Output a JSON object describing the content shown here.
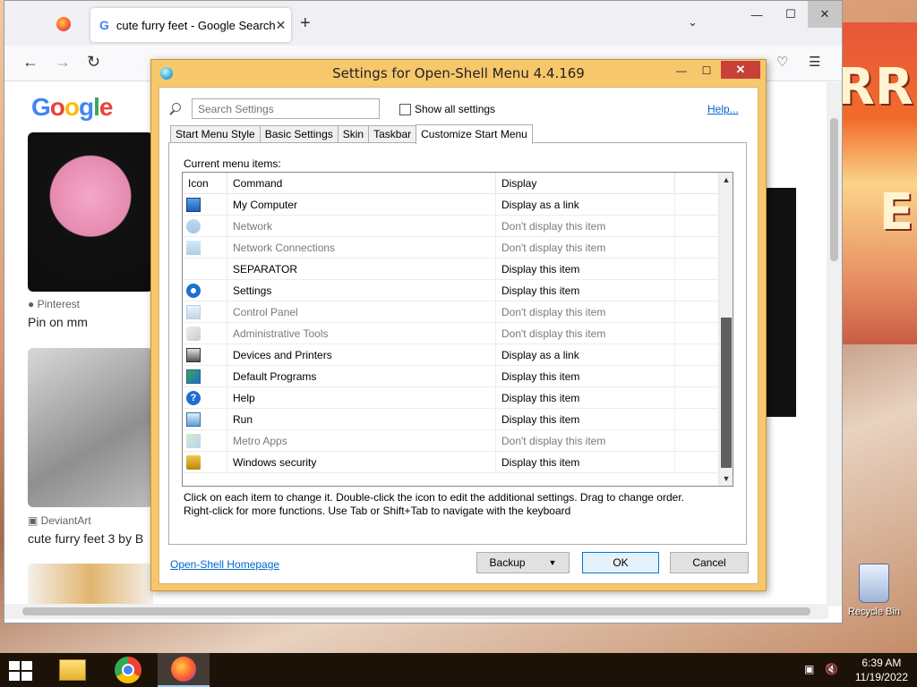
{
  "browser": {
    "tab_title": "cute furry feet - Google Search",
    "tab_close": "✕",
    "new_tab": "+",
    "tabs_menu": "⌄",
    "window_controls": [
      "—",
      "☐",
      "✕"
    ]
  },
  "page": {
    "logo": [
      "G",
      "o",
      "o",
      "g",
      "l",
      "e"
    ],
    "results": [
      {
        "source": "Pinterest",
        "title": "Pin on mm"
      },
      {
        "source": "DeviantArt",
        "title": "cute furry feet 3 by B"
      }
    ]
  },
  "dialog": {
    "title": "Settings for Open-Shell Menu 4.4.169",
    "controls": [
      "—",
      "☐",
      "✕"
    ],
    "search_placeholder": "Search Settings",
    "show_all_label": "Show all settings",
    "help_label": "Help...",
    "tabs": [
      "Start Menu Style",
      "Basic Settings",
      "Skin",
      "Taskbar",
      "Customize Start Menu"
    ],
    "active_tab": "Customize Start Menu",
    "current_items_label": "Current menu items:",
    "columns": [
      "Icon",
      "Command",
      "Display"
    ],
    "rows": [
      {
        "icon": "my-computer-icon",
        "command": "My Computer",
        "display": "Display as a link",
        "dim": false
      },
      {
        "icon": "network-icon",
        "command": "Network",
        "display": "Don't display this item",
        "dim": true
      },
      {
        "icon": "network-connections-icon",
        "command": "Network Connections",
        "display": "Don't display this item",
        "dim": true
      },
      {
        "icon": "",
        "command": "SEPARATOR",
        "display": "Display this item",
        "dim": false
      },
      {
        "icon": "settings-gear-icon",
        "command": "Settings",
        "display": "Display this item",
        "dim": false
      },
      {
        "icon": "control-panel-icon",
        "command": "Control Panel",
        "display": "Don't display this item",
        "dim": true
      },
      {
        "icon": "administrative-tools-icon",
        "command": "Administrative Tools",
        "display": "Don't display this item",
        "dim": true
      },
      {
        "icon": "printer-icon",
        "command": "Devices and Printers",
        "display": "Display as a link",
        "dim": false
      },
      {
        "icon": "default-programs-icon",
        "command": "Default Programs",
        "display": "Display this item",
        "dim": false
      },
      {
        "icon": "help-icon",
        "command": "Help",
        "display": "Display this item",
        "dim": false
      },
      {
        "icon": "run-icon",
        "command": "Run",
        "display": "Display this item",
        "dim": false
      },
      {
        "icon": "metro-apps-icon",
        "command": "Metro Apps",
        "display": "Don't display this item",
        "dim": true
      },
      {
        "icon": "lock-icon",
        "command": "Windows security",
        "display": "Display this item",
        "dim": false
      }
    ],
    "hint_line1": "Click on each item to change it. Double-click the icon to edit the additional settings. Drag to change order.",
    "hint_line2": "Right-click for more functions. Use Tab or Shift+Tab to navigate with the keyboard",
    "homepage_link": "Open-Shell Homepage",
    "backup_label": "Backup",
    "ok_label": "OK",
    "cancel_label": "Cancel"
  },
  "desktop": {
    "recycle_bin_label": "Recycle Bin"
  },
  "taskbar": {
    "time": "6:39 AM",
    "date": "11/19/2022"
  },
  "colors": {
    "dialog_frame": "#f7c76b",
    "close_button": "#c7403a",
    "link": "#0066cc"
  }
}
